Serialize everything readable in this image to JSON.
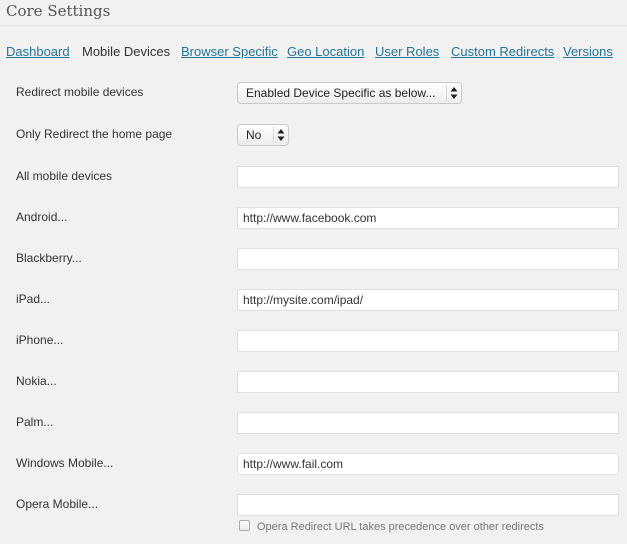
{
  "header": {
    "title": "Core Settings"
  },
  "tabs": [
    {
      "label": "Dashboard",
      "active": false
    },
    {
      "label": "Mobile Devices",
      "active": true
    },
    {
      "label": "Browser Specific",
      "active": false
    },
    {
      "label": "Geo Location",
      "active": false
    },
    {
      "label": "User Roles",
      "active": false
    },
    {
      "label": "Custom Redirects",
      "active": false
    },
    {
      "label": "Versions",
      "active": false
    }
  ],
  "settings": {
    "redirect_mobile": {
      "label": "Redirect mobile devices",
      "value": "Enabled Device Specific as below..."
    },
    "home_only": {
      "label": "Only Redirect the home page",
      "value": "No"
    }
  },
  "devices": [
    {
      "label": "All mobile devices",
      "value": ""
    },
    {
      "label": "Android...",
      "value": "http://www.facebook.com"
    },
    {
      "label": "Blackberry...",
      "value": ""
    },
    {
      "label": "iPad...",
      "value": "http://mysite.com/ipad/"
    },
    {
      "label": "iPhone...",
      "value": ""
    },
    {
      "label": "Nokia...",
      "value": ""
    },
    {
      "label": "Palm...",
      "value": ""
    },
    {
      "label": "Windows Mobile...",
      "value": "http://www.fail.com"
    },
    {
      "label": "Opera Mobile...",
      "value": ""
    }
  ],
  "opera_precedence": {
    "label": "Opera Redirect URL takes precedence over other redirects",
    "checked": false
  }
}
